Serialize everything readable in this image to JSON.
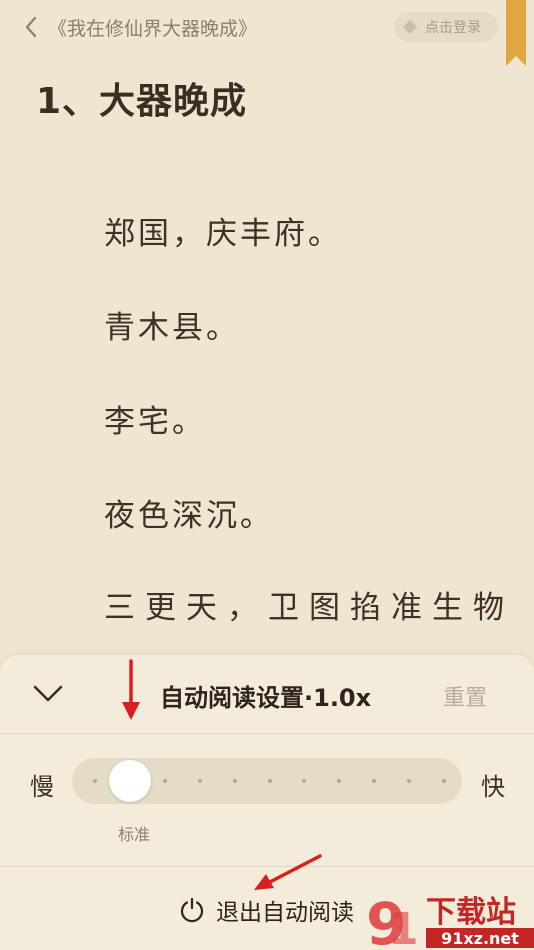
{
  "header": {
    "book_title": "《我在修仙界大器晚成》",
    "login_label": "点击登录"
  },
  "chapter": {
    "title": "1、大器晚成",
    "paragraphs": [
      "郑国，庆丰府。",
      "青木县。",
      "李宅。",
      "夜色深沉。",
      "三更天，卫图掐准生物"
    ]
  },
  "auto_read": {
    "title": "自动阅读设置·1.0x",
    "reset_label": "重置",
    "slow_label": "慢",
    "fast_label": "快",
    "standard_label": "标准",
    "exit_label": "退出自动阅读",
    "speed_steps": 11,
    "speed_index": 1
  },
  "watermark": {
    "logo_text": "下载站",
    "site_text": "91xz.net"
  },
  "colors": {
    "background": "#efe6d2",
    "panel": "#f4ecdb",
    "bookmark": "#e0a640",
    "annotation_arrow": "#d81e1e"
  }
}
